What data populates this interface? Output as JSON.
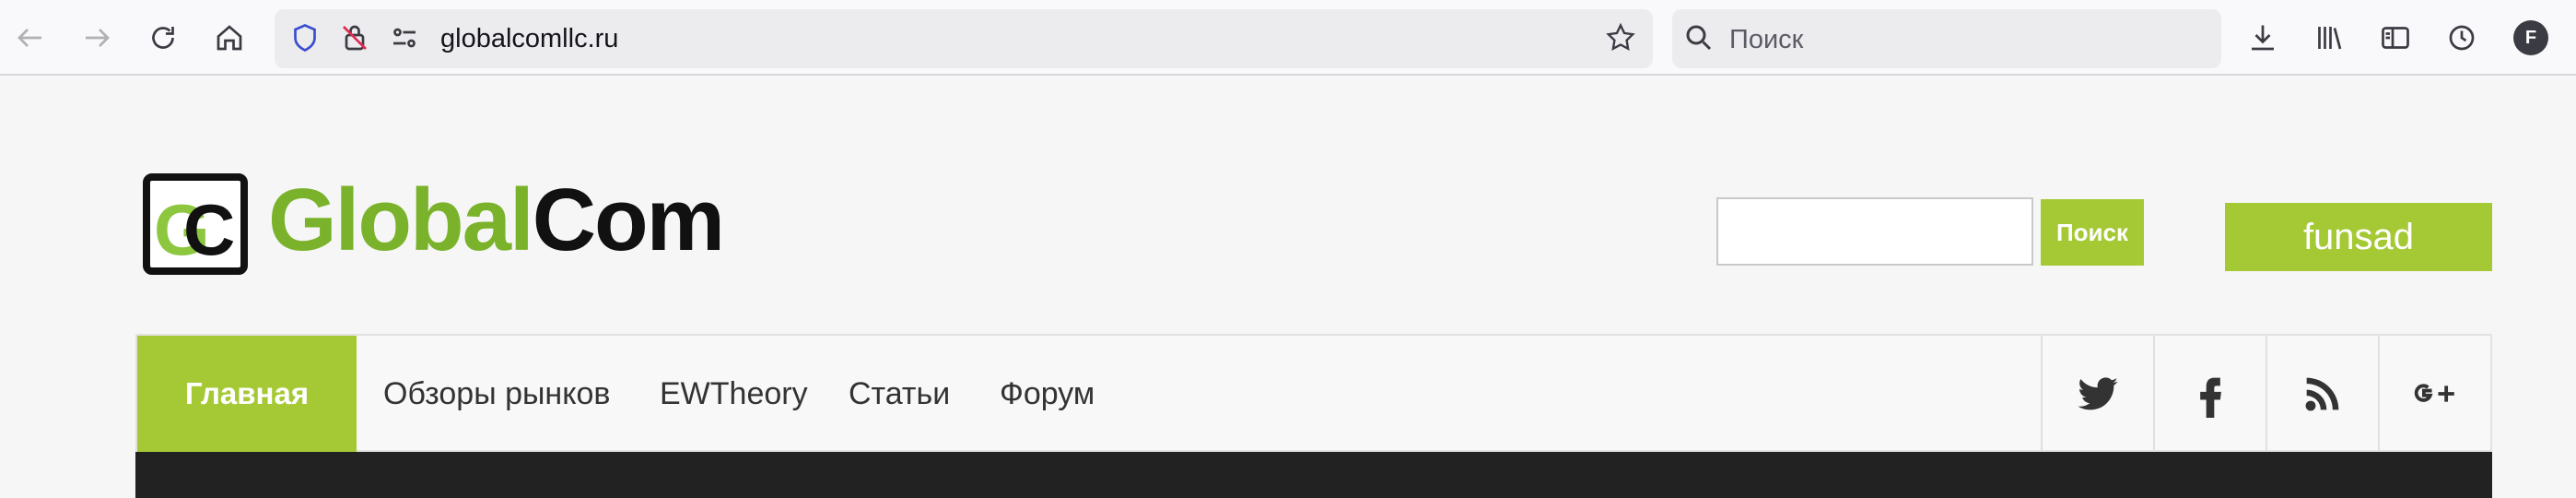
{
  "browser": {
    "url": "globalcomllc.ru",
    "search_placeholder": "Поиск",
    "profile_initial": "F"
  },
  "site": {
    "logo": {
      "text_part1": "Global",
      "text_part2": "Com"
    },
    "search_button_label": "Поиск",
    "user_button_label": "funsad",
    "nav": {
      "home_label": "Главная",
      "items": [
        "Обзоры рынков",
        "EWTheory",
        "Статьи",
        "Форум"
      ]
    },
    "social_icons": [
      "twitter-icon",
      "facebook-icon",
      "rss-icon",
      "google-plus-icon"
    ],
    "colors": {
      "accent": "#a5c934",
      "logo_green": "#7ab32b"
    }
  }
}
